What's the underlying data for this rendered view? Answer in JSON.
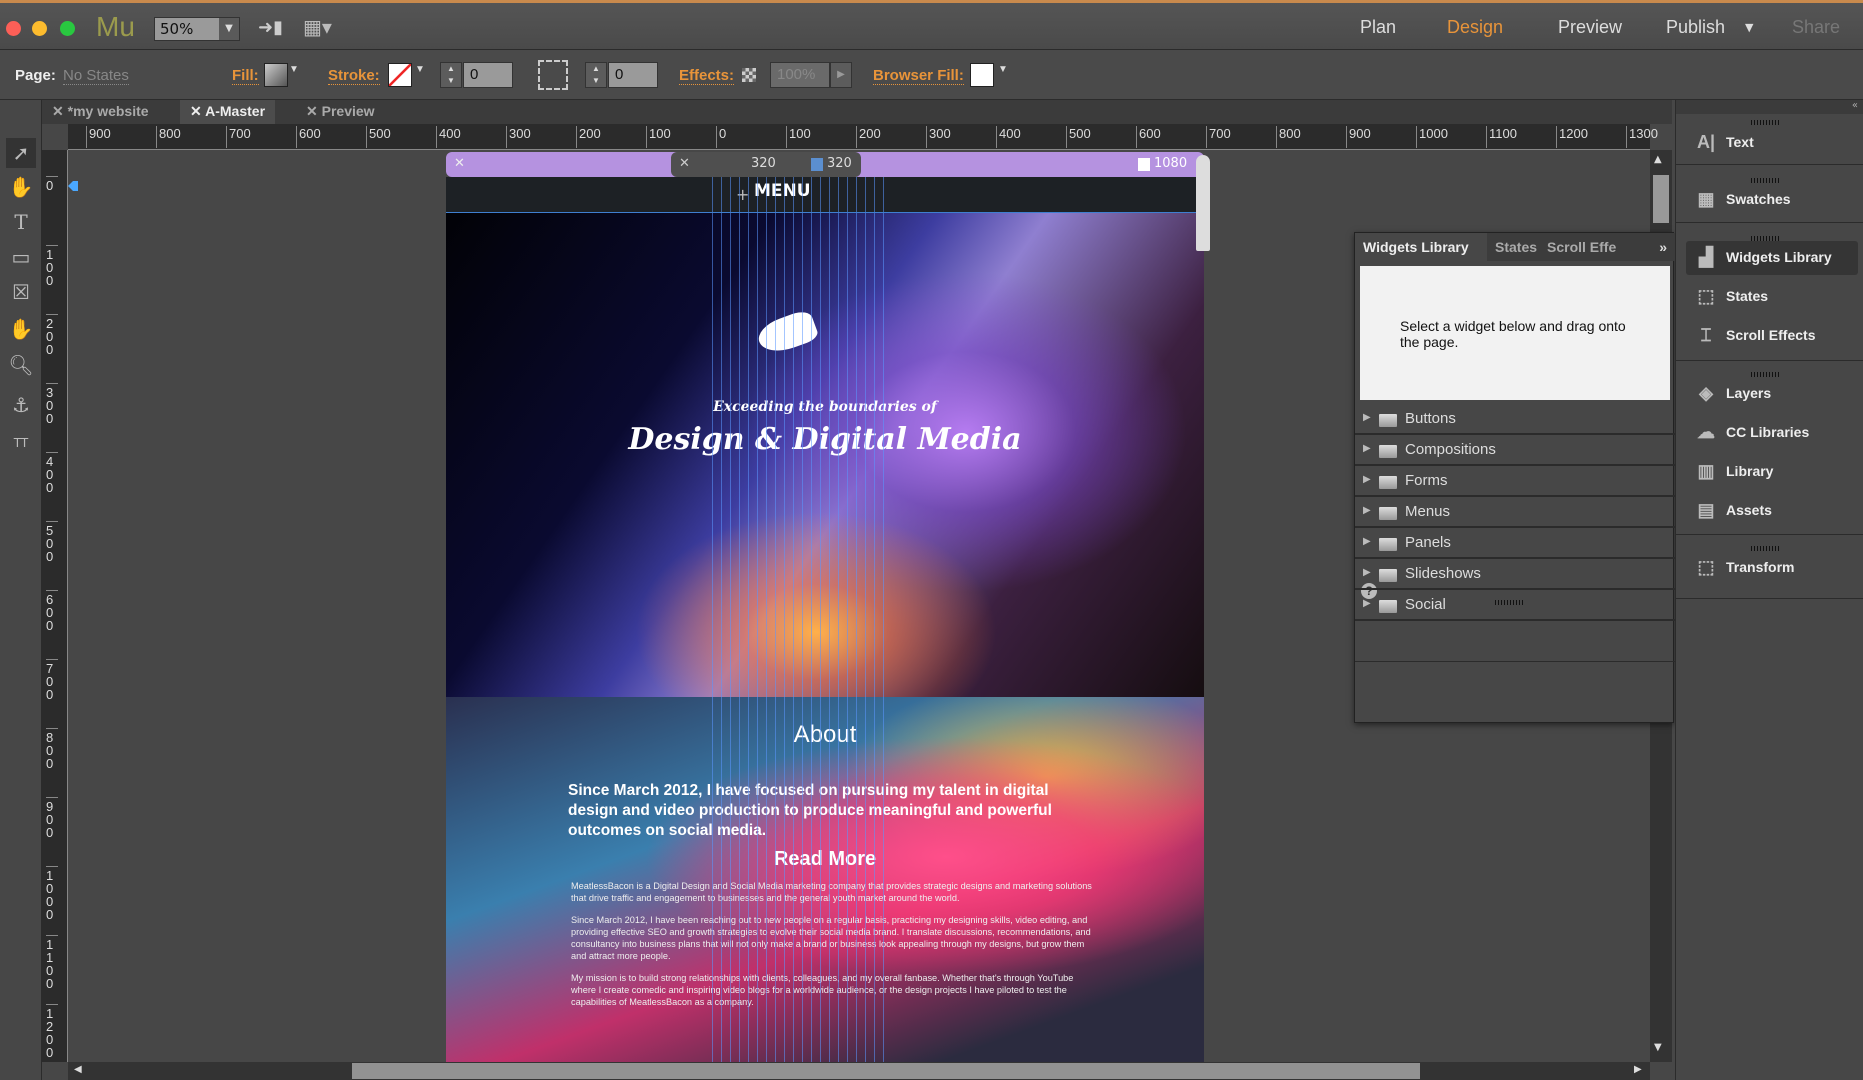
{
  "app": {
    "logo": "Mu",
    "zoom": "50%",
    "colors": {
      "accent": "#e8943a",
      "breakpoint_bar": "#b592e0"
    }
  },
  "nav": {
    "plan": "Plan",
    "design": "Design",
    "preview": "Preview",
    "publish": "Publish",
    "share": "Share"
  },
  "controls": {
    "page_label": "Page:",
    "page_state": "No States",
    "fill": "Fill:",
    "stroke": "Stroke:",
    "stroke_width": "0",
    "corner_radius": "0",
    "effects": "Effects:",
    "opacity": "100%",
    "browser_fill": "Browser Fill:"
  },
  "tabs": [
    {
      "label": "*my website"
    },
    {
      "label": "A-Master"
    },
    {
      "label": "Preview"
    }
  ],
  "ruler": {
    "h": [
      "900",
      "800",
      "700",
      "600",
      "500",
      "400",
      "300",
      "200",
      "100",
      "0",
      "100",
      "200",
      "300",
      "400",
      "500",
      "600",
      "700",
      "800",
      "900",
      "1000",
      "1100",
      "1200",
      "1300"
    ],
    "v": [
      "0",
      "100",
      "200",
      "300",
      "400",
      "500",
      "600",
      "700",
      "800",
      "900",
      "1000",
      "1100",
      "1200"
    ]
  },
  "breakpoints": {
    "current": "320",
    "marker": "320",
    "max": "1080"
  },
  "page": {
    "menu": "MENU",
    "tagline": "Exceeding the boundaries of",
    "headline": "Design & Digital Media",
    "about_title": "About",
    "about_lead": "Since March 2012, I have focused on pursuing my talent in digital design and video production to produce meaningful and powerful outcomes on social media.",
    "read_more": "Read More",
    "paragraphs": [
      "MeatlessBacon is a Digital Design and Social Media marketing company that provides strategic designs and marketing solutions that drive traffic and engagement to businesses and the general youth market around the world.",
      "Since March 2012, I have been reaching out to new people on a regular basis, practicing my designing skills, video editing, and providing effective SEO and growth strategies to evolve their social media brand. I translate discussions, recommendations, and consultancy into business plans that will not only make a brand or business look appealing through my designs, but grow them and attract more people.",
      "My mission is to build strong relationships with clients, colleagues, and my overall fanbase. Whether that's through YouTube where I create comedic and inspiring video blogs for a worldwide audience, or the design projects I have piloted to test the capabilities of MeatlessBacon as a company."
    ]
  },
  "widgets": {
    "tabs": [
      "Widgets Library",
      "States",
      "Scroll Effe"
    ],
    "hint": "Select a widget below and drag onto the page.",
    "categories": [
      "Buttons",
      "Compositions",
      "Forms",
      "Menus",
      "Panels",
      "Slideshows",
      "Social"
    ]
  },
  "panels": [
    "Text",
    "Swatches",
    "Widgets Library",
    "States",
    "Scroll Effects",
    "Layers",
    "CC Libraries",
    "Library",
    "Assets",
    "Transform"
  ]
}
